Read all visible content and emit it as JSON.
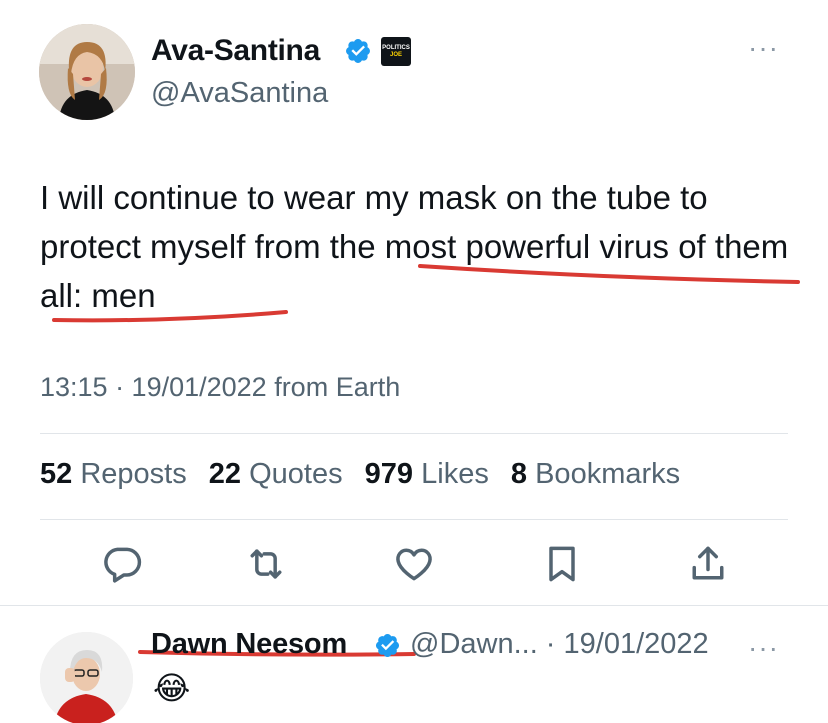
{
  "author": {
    "name": "Ava-Santina",
    "handle": "@AvaSantina",
    "verified_icon": "verified-badge-icon",
    "affiliation_badge_line1": "POLITICS",
    "affiliation_badge_line2": "JOE"
  },
  "tweet": {
    "text_part1": "I will continue to wear my mask on the tube to protect myself from the ",
    "text_underlined_1": "most powerful virus of",
    "text_underlined_2": "them all: men",
    "timestamp": "13:15 · 19/01/2022 from Earth"
  },
  "stats": {
    "reposts_count": "52",
    "reposts_label": "Reposts",
    "quotes_count": "22",
    "quotes_label": "Quotes",
    "likes_count": "979",
    "likes_label": "Likes",
    "bookmarks_count": "8",
    "bookmarks_label": "Bookmarks"
  },
  "actions": [
    "reply-icon",
    "repost-icon",
    "like-icon",
    "bookmark-icon",
    "share-icon"
  ],
  "reply": {
    "name": "Dawn Neesom",
    "handle_date": "@Dawn... · 19/01/2022",
    "text": "😂"
  },
  "colors": {
    "verified": "#1d9bf0",
    "secondary_text": "#536471",
    "annotation_red": "#d93a33"
  }
}
